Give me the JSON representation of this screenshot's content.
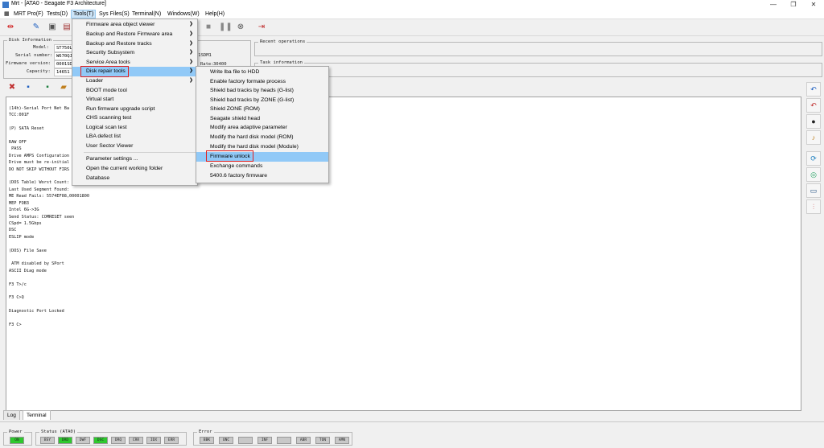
{
  "window": {
    "title": "Mrt - [ATA0 - Seagate F3 Architecture]",
    "controls": [
      "—",
      "❐",
      "✕"
    ]
  },
  "menubar": {
    "items": [
      "MRT Pro(F)",
      "Tests(D)",
      "Tools(T)",
      "Sys Files(S)",
      "Terminal(N)",
      "Windows(W)",
      "Help(H)"
    ]
  },
  "disk_info": {
    "title": "Disk Information",
    "model_label": "Model:",
    "model_value": "ST750LX",
    "serial_label": "Serial number:",
    "serial_value": "W670QJ",
    "fw_label": "Firmware version:",
    "fw_value": "0001SD",
    "cap_label": "Capacity:",
    "cap_value": "14651",
    "fw_value2": "01SDM1",
    "rate_label": "Rate:",
    "rate_value": "30400"
  },
  "recent_ops": {
    "title": "Recent operations"
  },
  "task_info": {
    "title": "Task information"
  },
  "tools_menu": {
    "items": [
      {
        "label": "Firmware area object viewer",
        "sub": true
      },
      {
        "label": "Backup and Restore Firmware area",
        "sub": true
      },
      {
        "label": "Backup and Restore tracks",
        "sub": true
      },
      {
        "label": "Security Subsystem",
        "sub": true
      },
      {
        "label": "Service Area tools",
        "sub": true
      },
      {
        "label": "Disk repair tools",
        "sub": true
      },
      {
        "label": "Loader",
        "sub": true
      },
      {
        "label": "BOOT mode tool",
        "sub": false
      },
      {
        "label": "Virtual start",
        "sub": false
      },
      {
        "label": "Run firmware upgrade script",
        "sub": false
      },
      {
        "label": "CHS scanning test",
        "sub": false
      },
      {
        "label": "Logical scan test",
        "sub": false
      },
      {
        "label": "LBA defect list",
        "sub": false
      },
      {
        "label": "User Sector Viewer",
        "sub": false
      },
      {
        "label": "Parameter settings ...",
        "sub": false
      },
      {
        "label": "Open the current working folder",
        "sub": false
      },
      {
        "label": "Database",
        "sub": false
      }
    ]
  },
  "repair_menu": {
    "items": [
      "Write lba file to HDD",
      "Enable factory formate process",
      "Shield bad tracks by heads (G-list)",
      "Shield bad tracks by ZONE (G-list)",
      "Shield ZONE (ROM)",
      "Seagate shield head",
      "Modify area adaptive parameter",
      "Modify the hard disk model (ROM)",
      "Modify the hard disk model (Module)",
      "Firmware unlock",
      "Exchange commands",
      "5400.6 factory firmware"
    ]
  },
  "terminal": {
    "text": "(14h)-Serial Port Net Ba\nTCC:001F\n\n(P) SATA Reset\n\nRAW OFF\n PASS\nDrive AMPS Configuration\nDrive must be re-initial\nDO NOT SKIP WITHOUT FIRS\n\n(DOS Table) Worst Count: 00000200 at 20: 00000300\nLast Used Segment Found:\nME Read Fails: 5574EF08,00001800\nMEP FOB3\nIntel 6G->3G\nSend Status: COMRESET seen\nCSpd= 1.5Gbps\nDSC\nESLIP mode\n\n(DOS) File Save\n\n ATM disabled by SPort\nASCII Diag mode\n\nF3 T>/c\n\nF3 C>Q\n\nDiagnostic Port Locked\n\nF3 C>"
  },
  "tabs": [
    "Log",
    "Terminal"
  ],
  "status": {
    "power_title": "Power",
    "power_ind": "ON",
    "status_title": "Status (ATA0)",
    "status_inds": [
      "BSY",
      "DRD",
      "DWF",
      "DSC",
      "DRQ",
      "CRR",
      "IDX",
      "ERR"
    ],
    "status_on": [
      "DRD",
      "DSC"
    ],
    "error_title": "Error",
    "error_inds": [
      "BBK",
      "UNC",
      "",
      "INF",
      "",
      "ABR",
      "TON",
      "AMN"
    ]
  },
  "colors": {
    "highlight": "#91c9f7",
    "red_box": "#e02020",
    "indicator_on": "#2ec82e"
  }
}
